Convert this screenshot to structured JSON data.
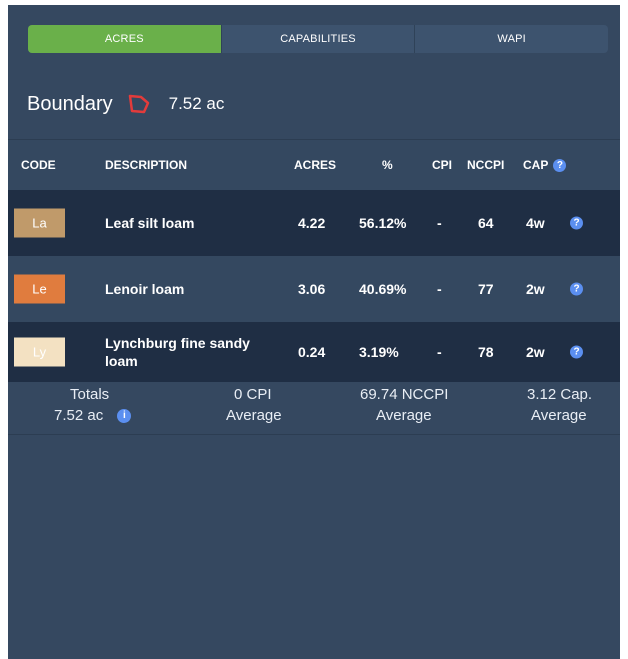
{
  "tabs": [
    {
      "label": "ACRES",
      "active": true
    },
    {
      "label": "CAPABILITIES",
      "active": false
    },
    {
      "label": "WAPI",
      "active": false
    }
  ],
  "boundary": {
    "title": "Boundary",
    "acres": "7.52 ac",
    "icon": "boundary-shape-icon",
    "icon_color": "#e23b3b"
  },
  "table": {
    "headers": {
      "code": "CODE",
      "description": "DESCRIPTION",
      "acres": "ACRES",
      "percent": "%",
      "cpi": "CPI",
      "nccpi": "NCCPI",
      "cap": "CAP"
    },
    "rows": [
      {
        "code": "La",
        "color": "#c09a6a",
        "text_color": "#ffffff",
        "description": "Leaf silt loam",
        "acres": "4.22",
        "percent": "56.12%",
        "cpi": "-",
        "nccpi": "64",
        "cap": "4w"
      },
      {
        "code": "Le",
        "color": "#e07c3e",
        "text_color": "#ffffff",
        "description": "Lenoir loam",
        "acres": "3.06",
        "percent": "40.69%",
        "cpi": "-",
        "nccpi": "77",
        "cap": "2w"
      },
      {
        "code": "Ly",
        "color": "#f3e1c2",
        "text_color": "#ffffff",
        "description": "Lynchburg fine sandy loam",
        "acres": "0.24",
        "percent": "3.19%",
        "cpi": "-",
        "nccpi": "78",
        "cap": "2w"
      }
    ]
  },
  "totals": {
    "label": "Totals",
    "acres": "7.52 ac",
    "cpi": "0 CPI",
    "cpi_sub": "Average",
    "nccpi": "69.74 NCCPI",
    "nccpi_sub": "Average",
    "cap": "3.12 Cap.",
    "cap_sub": "Average"
  },
  "colors": {
    "panel": "#354860",
    "row_dark": "#1f2e44",
    "active_tab": "#6ab04a",
    "help_icon": "#5b8ff0"
  }
}
